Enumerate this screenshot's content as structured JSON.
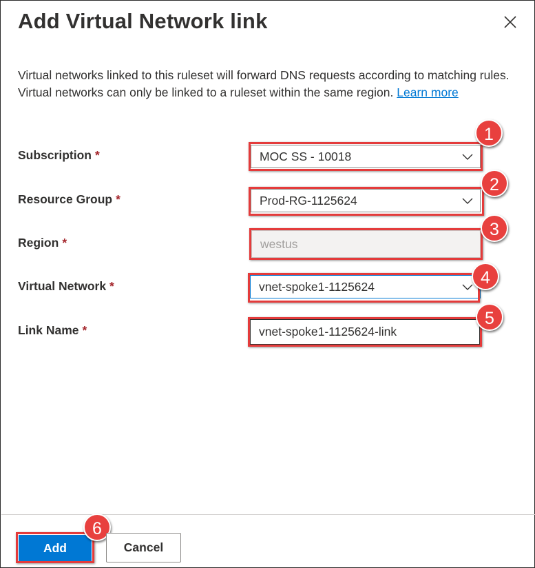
{
  "panel": {
    "title": "Add Virtual Network link",
    "description": "Virtual networks linked to this ruleset will forward DNS requests according to matching rules. Virtual networks can only be linked to a ruleset within the same region.",
    "learn_more": "Learn more"
  },
  "form": {
    "required_marker": "*",
    "subscription": {
      "label": "Subscription",
      "value": "MOC SS - 10018"
    },
    "resource_group": {
      "label": "Resource Group",
      "value": "Prod-RG-1125624"
    },
    "region": {
      "label": "Region",
      "value": "westus"
    },
    "virtual_network": {
      "label": "Virtual Network",
      "value": "vnet-spoke1-1125624"
    },
    "link_name": {
      "label": "Link Name",
      "value": "vnet-spoke1-1125624-link"
    }
  },
  "footer": {
    "add_label": "Add",
    "cancel_label": "Cancel"
  },
  "annotations": {
    "badges": [
      "1",
      "2",
      "3",
      "4",
      "5",
      "6"
    ],
    "highlight_color": "#e43b3b"
  },
  "colors": {
    "accent": "#0078d4",
    "required": "#a4262c"
  },
  "icons": {
    "close": "close-icon",
    "dropdown": "chevron-down-icon"
  }
}
